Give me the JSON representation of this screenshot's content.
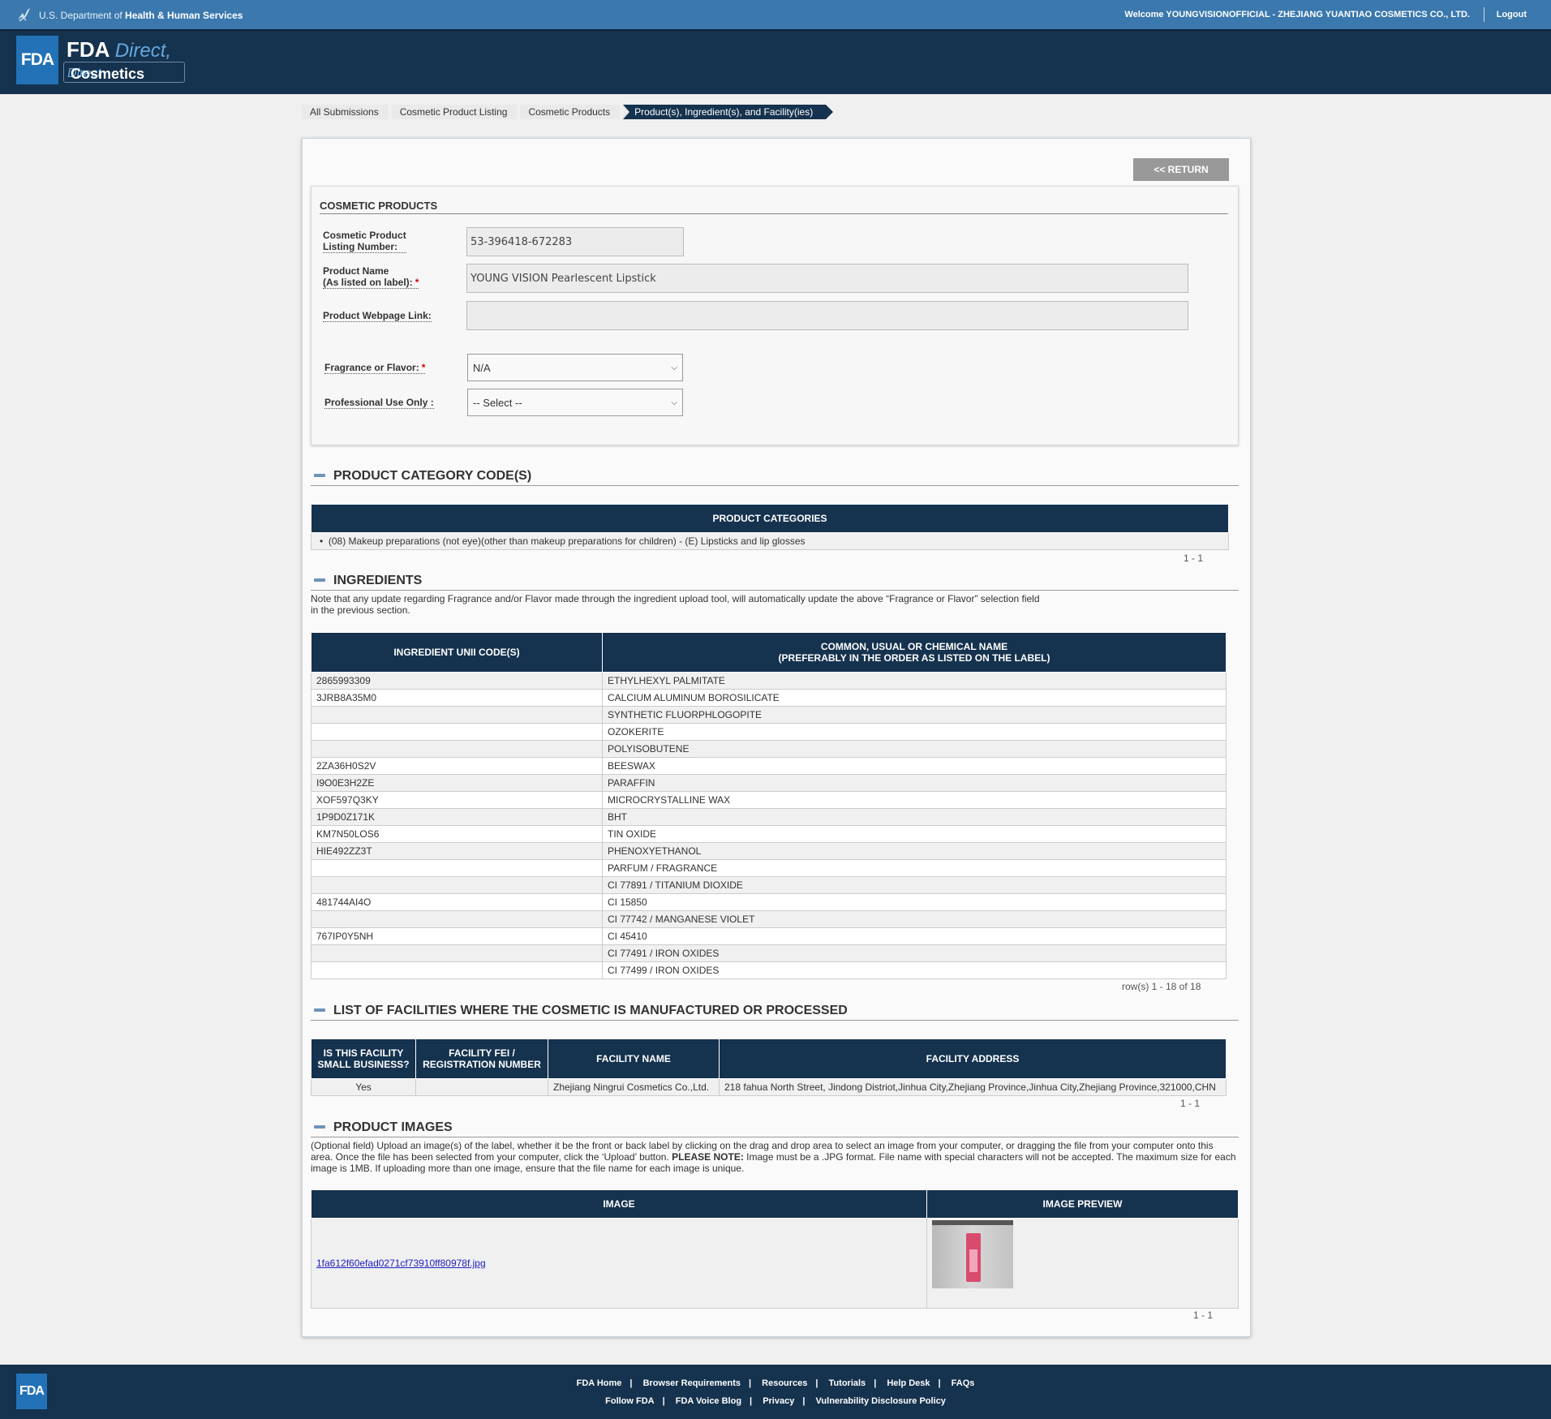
{
  "topbar": {
    "agency_prefix": "U.S. Department of ",
    "agency_bold": "Health & Human Services",
    "welcome": "Welcome YOUNGVISIONOFFICIAL - ZHEJIANG YUANTIAO COSMETICS CO., LTD.",
    "logout": "Logout"
  },
  "header": {
    "logo": "FDA",
    "brand1_bold": "FDA ",
    "brand1_italic": "Direct,",
    "brand2_bold": "Cosmetics ",
    "brand2_italic": "Direct"
  },
  "breadcrumb": [
    "All Submissions",
    "Cosmetic Product Listing",
    "Cosmetic Products",
    "Product(s), Ingredient(s), and Facility(ies)"
  ],
  "return_button": "<< RETURN",
  "cosmetic_products": {
    "title": "COSMETIC PRODUCTS",
    "listing_label_1": "Cosmetic Product",
    "listing_label_2": "Listing Number:",
    "listing_value": "53-396418-672283",
    "name_label_1": "Product Name",
    "name_label_2": "(As listed on label):",
    "name_value": "YOUNG VISION Pearlescent Lipstick",
    "webpage_label": "Product Webpage Link:",
    "webpage_value": "",
    "fragrance_label": "Fragrance or Flavor:",
    "fragrance_value": "N/A",
    "pro_label": "Professional Use Only :",
    "pro_value": "-- Select --",
    "required_mark": "*"
  },
  "category": {
    "section_title": "PRODUCT CATEGORY CODE(S)",
    "header": "PRODUCT CATEGORIES",
    "item": "(08) Makeup preparations (not eye)(other than makeup preparations for children) - (E) Lipsticks and lip glosses",
    "pager": "1 - 1"
  },
  "ingredients": {
    "section_title": "INGREDIENTS",
    "note_1": "Note that any update regarding Fragrance and/or Flavor made through the ingredient upload tool, will automatically update the above “Fragrance or Flavor” selection field",
    "note_2": "in the previous section.",
    "col1": "INGREDIENT UNII CODE(S)",
    "col2_1": "COMMON, USUAL OR CHEMICAL NAME",
    "col2_2": "(PREFERABLY IN THE ORDER AS LISTED ON THE LABEL)",
    "rows": [
      [
        "2865993309",
        "ETHYLHEXYL PALMITATE"
      ],
      [
        "3JRB8A35M0",
        "CALCIUM ALUMINUM BOROSILICATE"
      ],
      [
        "",
        "SYNTHETIC FLUORPHLOGOPITE"
      ],
      [
        "",
        "OZOKERITE"
      ],
      [
        "",
        "POLYISOBUTENE"
      ],
      [
        "2ZA36H0S2V",
        "BEESWAX"
      ],
      [
        "I9O0E3H2ZE",
        "PARAFFIN"
      ],
      [
        "XOF597Q3KY",
        "MICROCRYSTALLINE WAX"
      ],
      [
        "1P9D0Z171K",
        "BHT"
      ],
      [
        "KM7N50LOS6",
        "TIN OXIDE"
      ],
      [
        "HIE492ZZ3T",
        "PHENOXYETHANOL"
      ],
      [
        "",
        "PARFUM / FRAGRANCE"
      ],
      [
        "",
        "CI 77891 / TITANIUM DIOXIDE"
      ],
      [
        "481744AI4O",
        "CI 15850"
      ],
      [
        "",
        "CI 77742 / MANGANESE VIOLET"
      ],
      [
        "767IP0Y5NH",
        "CI 45410"
      ],
      [
        "",
        "CI 77491 / IRON OXIDES"
      ],
      [
        "",
        "CI 77499 / IRON OXIDES"
      ]
    ],
    "pager": "row(s) 1 - 18 of 18"
  },
  "facilities": {
    "section_title": "LIST OF FACILITIES WHERE THE COSMETIC IS MANUFACTURED OR PROCESSED",
    "col1_1": "IS THIS FACILITY",
    "col1_2": "SMALL BUSINESS?",
    "col2_1": "FACILITY FEI /",
    "col2_2": "REGISTRATION NUMBER",
    "col3": "FACILITY NAME",
    "col4": "FACILITY ADDRESS",
    "row": {
      "small_business": "Yes",
      "fei": "",
      "name": "Zhejiang Ningrui Cosmetics Co.,Ltd.",
      "address": "218 fahua North Street, Jindong Distriot,Jinhua City,Zhejiang Province,Jinhua City,Zhejiang Province,321000,CHN"
    },
    "pager": "1 - 1"
  },
  "images": {
    "section_title": "PRODUCT IMAGES",
    "note_1": "(Optional field) Upload an image(s) of the label, whether it be the front or back label by clicking on the drag and drop area to select an image from your computer, or dragging the file from your computer onto this",
    "note_2_a": "area. Once the file has been selected from your computer, click the ‘Upload’ button. ",
    "note_2_b": "PLEASE NOTE:",
    "note_2_c": " Image must be a .JPG format. File name with special characters will not be accepted. The maximum size for each",
    "note_3": "image is 1MB. If uploading more than one image, ensure that the file name for each image is unique.",
    "col1": "IMAGE",
    "col2": "IMAGE PREVIEW",
    "file": "1fa612f60efad0271cf73910ff80978f.jpg",
    "pager": "1 - 1"
  },
  "footer": {
    "logo": "FDA",
    "links_row1": [
      "FDA Home",
      "Browser Requirements",
      "Resources",
      "Tutorials",
      "Help Desk",
      "FAQs"
    ],
    "links_row2": [
      "Follow FDA",
      "FDA Voice Blog",
      "Privacy",
      "Vulnerability Disclosure Policy"
    ],
    "separator": "|"
  }
}
